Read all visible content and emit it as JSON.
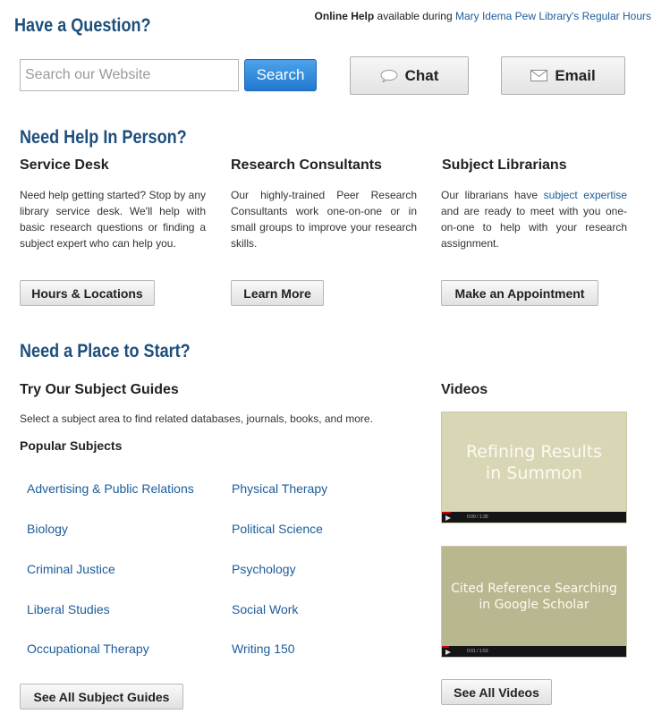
{
  "header": {
    "title": "Have a Question?",
    "online_help_bold": "Online Help",
    "online_help_text": " available during ",
    "hours_link": "Mary Idema Pew Library's Regular Hours"
  },
  "search": {
    "placeholder": "Search our Website",
    "button": "Search"
  },
  "chat": {
    "label": "Chat",
    "icon": "chat-bubble-icon"
  },
  "email": {
    "label": "Email",
    "icon": "envelope-icon"
  },
  "in_person": {
    "title": "Need Help In Person?",
    "service_desk": {
      "heading": "Service Desk",
      "body": "Need help getting started? Stop by any library service desk. We'll help with basic research questions or finding a subject expert who can help you.",
      "button": "Hours & Locations"
    },
    "research": {
      "heading": "Research Consultants",
      "body": "Our highly-trained Peer Research Consultants work one-on-one or in small groups to improve your research skills.",
      "button": "Learn More"
    },
    "librarians": {
      "heading": "Subject Librarians",
      "body_before": "Our librarians have ",
      "body_link": "subject expertise",
      "body_after": " and are ready to meet with you one-on-one to help with your research assignment.",
      "button": "Make an Appointment"
    }
  },
  "start": {
    "title": "Need a Place to Start?",
    "guides": {
      "heading": "Try Our Subject Guides",
      "intro": "Select a subject area to find related databases, journals, books, and more.",
      "popular": "Popular Subjects",
      "subjects_left": [
        "Advertising & Public Relations",
        "Biology",
        "Criminal Justice",
        "Liberal Studies",
        "Occupational Therapy"
      ],
      "subjects_right": [
        "Physical Therapy",
        "Political Science",
        "Psychology",
        "Social Work",
        "Writing 150"
      ],
      "button": "See All Subject Guides"
    },
    "videos": {
      "heading": "Videos",
      "video1": {
        "line1": "Refining Results",
        "line2": "in Summon",
        "time": "0:00 / 1:35",
        "progress": 0.05,
        "bg": "#d9d6b5"
      },
      "video2": {
        "line1": "Cited Reference Searching",
        "line2": "in Google Scholar",
        "time": "0:01 / 1:53",
        "progress": 0.04,
        "bg": "#b9b78f"
      },
      "button": "See All Videos"
    }
  },
  "colors": {
    "heading": "#1d4f7c",
    "link": "#1d5c9a",
    "search_button": "#2a84d8"
  }
}
